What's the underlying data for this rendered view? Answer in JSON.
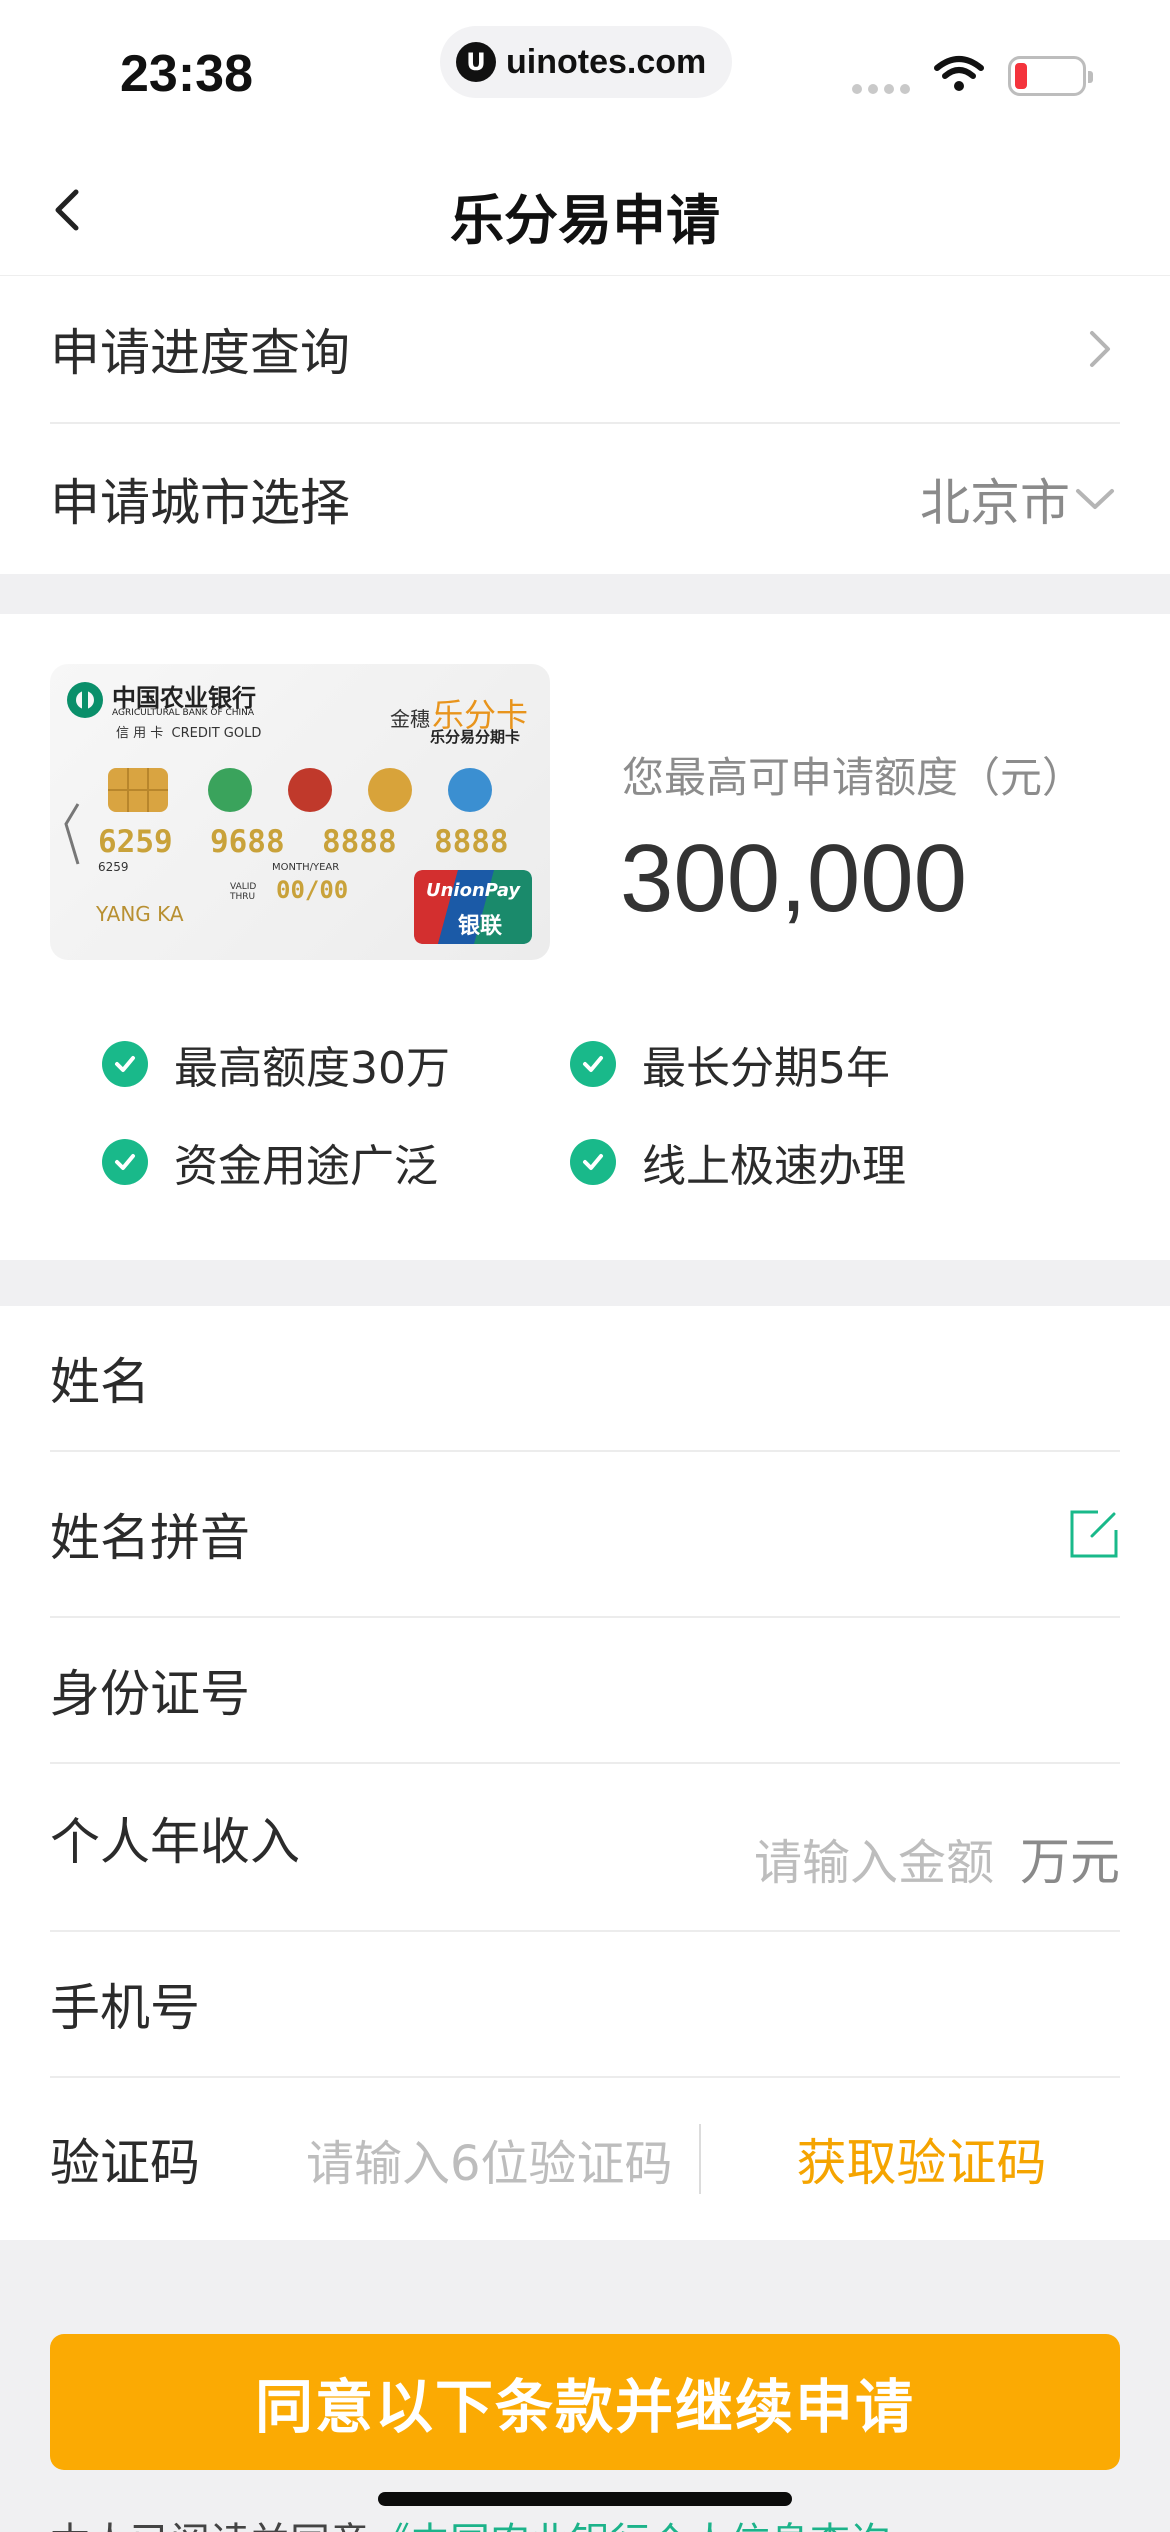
{
  "status_bar": {
    "time": "23:38",
    "url": "uinotes.com",
    "url_logo": "U"
  },
  "nav": {
    "title": "乐分易申请",
    "back_icon": "chevron-left-icon"
  },
  "top_section": {
    "progress_query": "申请进度查询",
    "city_select_label": "申请城市选择",
    "city_value": "北京市"
  },
  "card": {
    "bank_name_cn": "中国农业银行",
    "bank_name_en": "AGRICULTURAL BANK OF CHINA",
    "card_type": "信 用 卡  CREDIT GOLD",
    "brand_prefix": "金穗",
    "brand_name": "乐分卡",
    "brand_sub": "乐分易分期卡",
    "number": "6259  9688  8888  8888",
    "number_small": "6259",
    "valid_label_1": "VALID",
    "valid_label_2": "THRU",
    "month_year_label": "MONTH/YEAR",
    "expiry": "00/00",
    "holder": "YANG KA",
    "unionpay_en": "UnionPay",
    "unionpay_cn": "银联"
  },
  "quota": {
    "label": "您最高可申请额度（元）",
    "value": "300,000"
  },
  "features": [
    "最高额度30万",
    "最长分期5年",
    "资金用途广泛",
    "线上极速办理"
  ],
  "form": {
    "name_label": "姓名",
    "pinyin_label": "姓名拼音",
    "id_label": "身份证号",
    "income_label": "个人年收入",
    "income_placeholder": "请输入金额",
    "income_unit": "万元",
    "phone_label": "手机号",
    "code_label": "验证码",
    "code_placeholder": "请输入6位验证码",
    "get_code": "获取验证码"
  },
  "submit_label": "同意以下条款并继续申请",
  "footer_text": "本人已阅读并同意",
  "footer_link": "《中国农业银行个人信息查询",
  "colors": {
    "accent": "#fbaa03",
    "check": "#19b98a",
    "code": "#f5a400",
    "link": "#1cb38a"
  }
}
